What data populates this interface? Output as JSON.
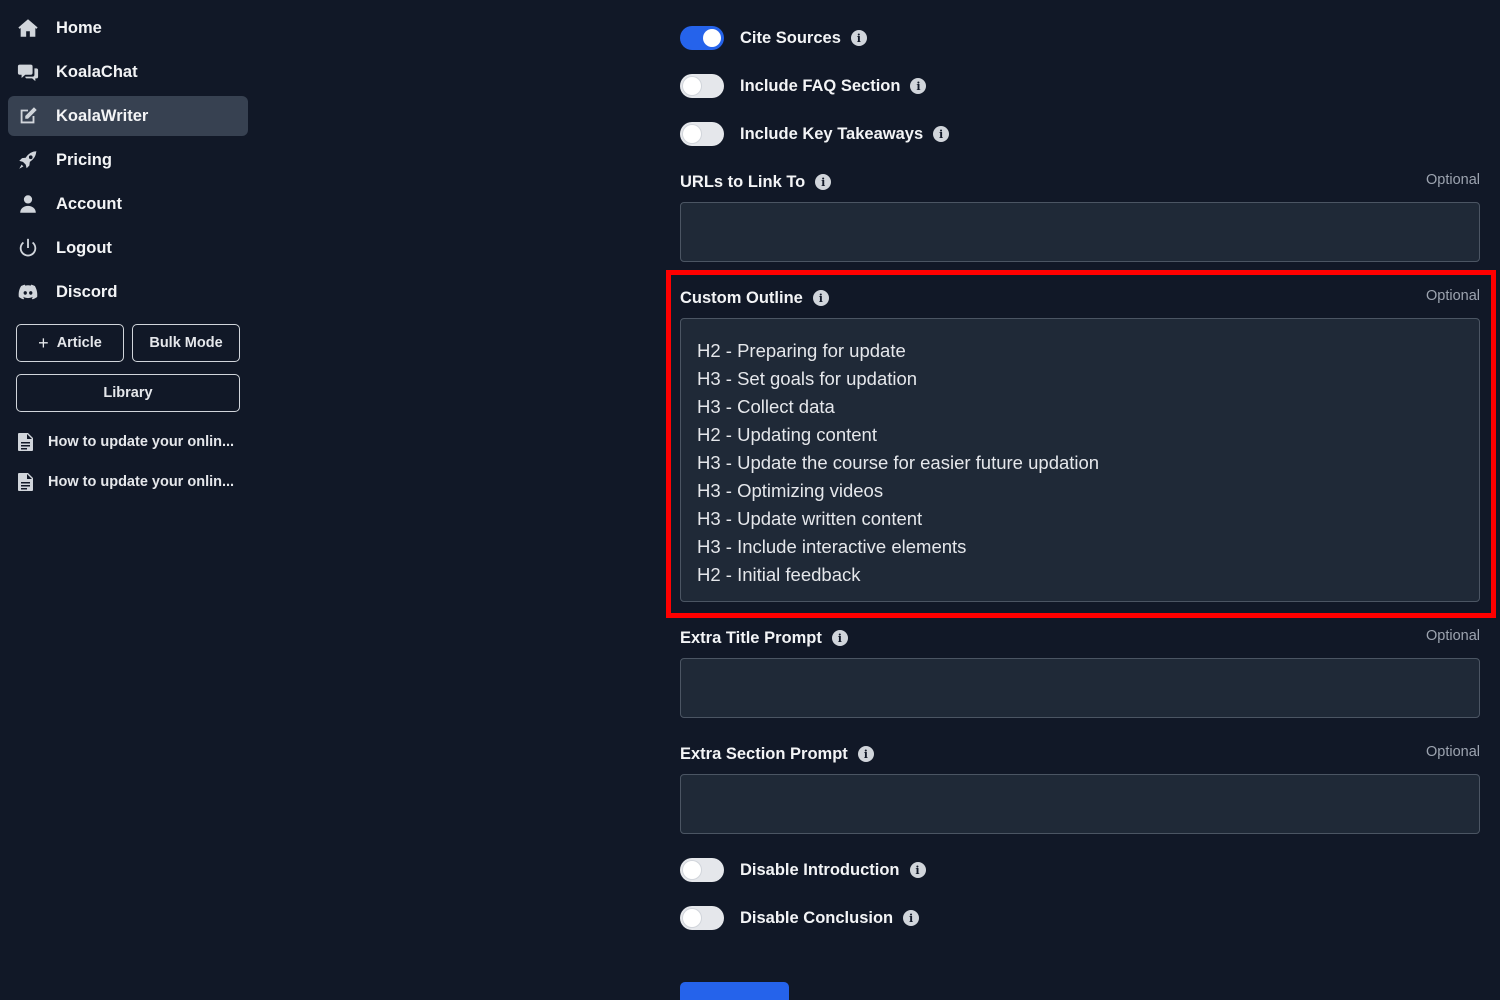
{
  "sidebar": {
    "nav": [
      {
        "label": "Home",
        "icon": "home-icon"
      },
      {
        "label": "KoalaChat",
        "icon": "chat-icon"
      },
      {
        "label": "KoalaWriter",
        "icon": "edit-icon",
        "active": true
      },
      {
        "label": "Pricing",
        "icon": "rocket-icon"
      },
      {
        "label": "Account",
        "icon": "user-icon"
      },
      {
        "label": "Logout",
        "icon": "power-icon"
      },
      {
        "label": "Discord",
        "icon": "discord-icon"
      }
    ],
    "article_button": "Article",
    "bulk_mode_button": "Bulk Mode",
    "library_button": "Library",
    "documents": [
      {
        "title": "How to update your onlin...",
        "icon": "document-icon"
      },
      {
        "title": "How to update your onlin...",
        "icon": "document-icon"
      }
    ]
  },
  "form": {
    "toggles_top": [
      {
        "label": "Cite Sources",
        "on": true
      },
      {
        "label": "Include FAQ Section",
        "on": false
      },
      {
        "label": "Include Key Takeaways",
        "on": false
      }
    ],
    "urls_field": {
      "label": "URLs to Link To",
      "optional": "Optional",
      "value": ""
    },
    "custom_outline": {
      "label": "Custom Outline",
      "optional": "Optional",
      "lines": [
        "H2 - Preparing for update",
        "H3 - Set goals for updation",
        "H3 - Collect data",
        "H2 - Updating content",
        "H3 - Update the course for easier future updation",
        "H3 - Optimizing videos",
        "H3 - Update written content",
        "H3 - Include interactive elements",
        "H2 - Initial feedback"
      ]
    },
    "extra_title_prompt": {
      "label": "Extra Title Prompt",
      "optional": "Optional",
      "value": ""
    },
    "extra_section_prompt": {
      "label": "Extra Section Prompt",
      "optional": "Optional",
      "value": ""
    },
    "toggles_bottom": [
      {
        "label": "Disable Introduction",
        "on": false
      },
      {
        "label": "Disable Conclusion",
        "on": false
      }
    ]
  },
  "colors": {
    "background": "#111827",
    "accent": "#2563eb",
    "highlight": "#ff0000",
    "input_bg": "#1f2937"
  }
}
